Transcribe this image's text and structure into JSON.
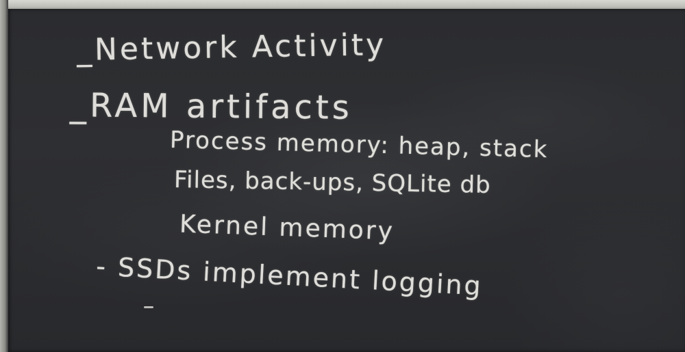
{
  "board": {
    "lines": [
      "_Network Activity",
      "_RAM artifacts",
      "Process memory: heap, stack",
      "Files, back-ups, SQLite db",
      "Kernel memory",
      "- SSDs implement logging"
    ]
  },
  "colors": {
    "board": "#2c2d30",
    "chalk": "#ecebe6",
    "frame": "#c9c9c4"
  }
}
